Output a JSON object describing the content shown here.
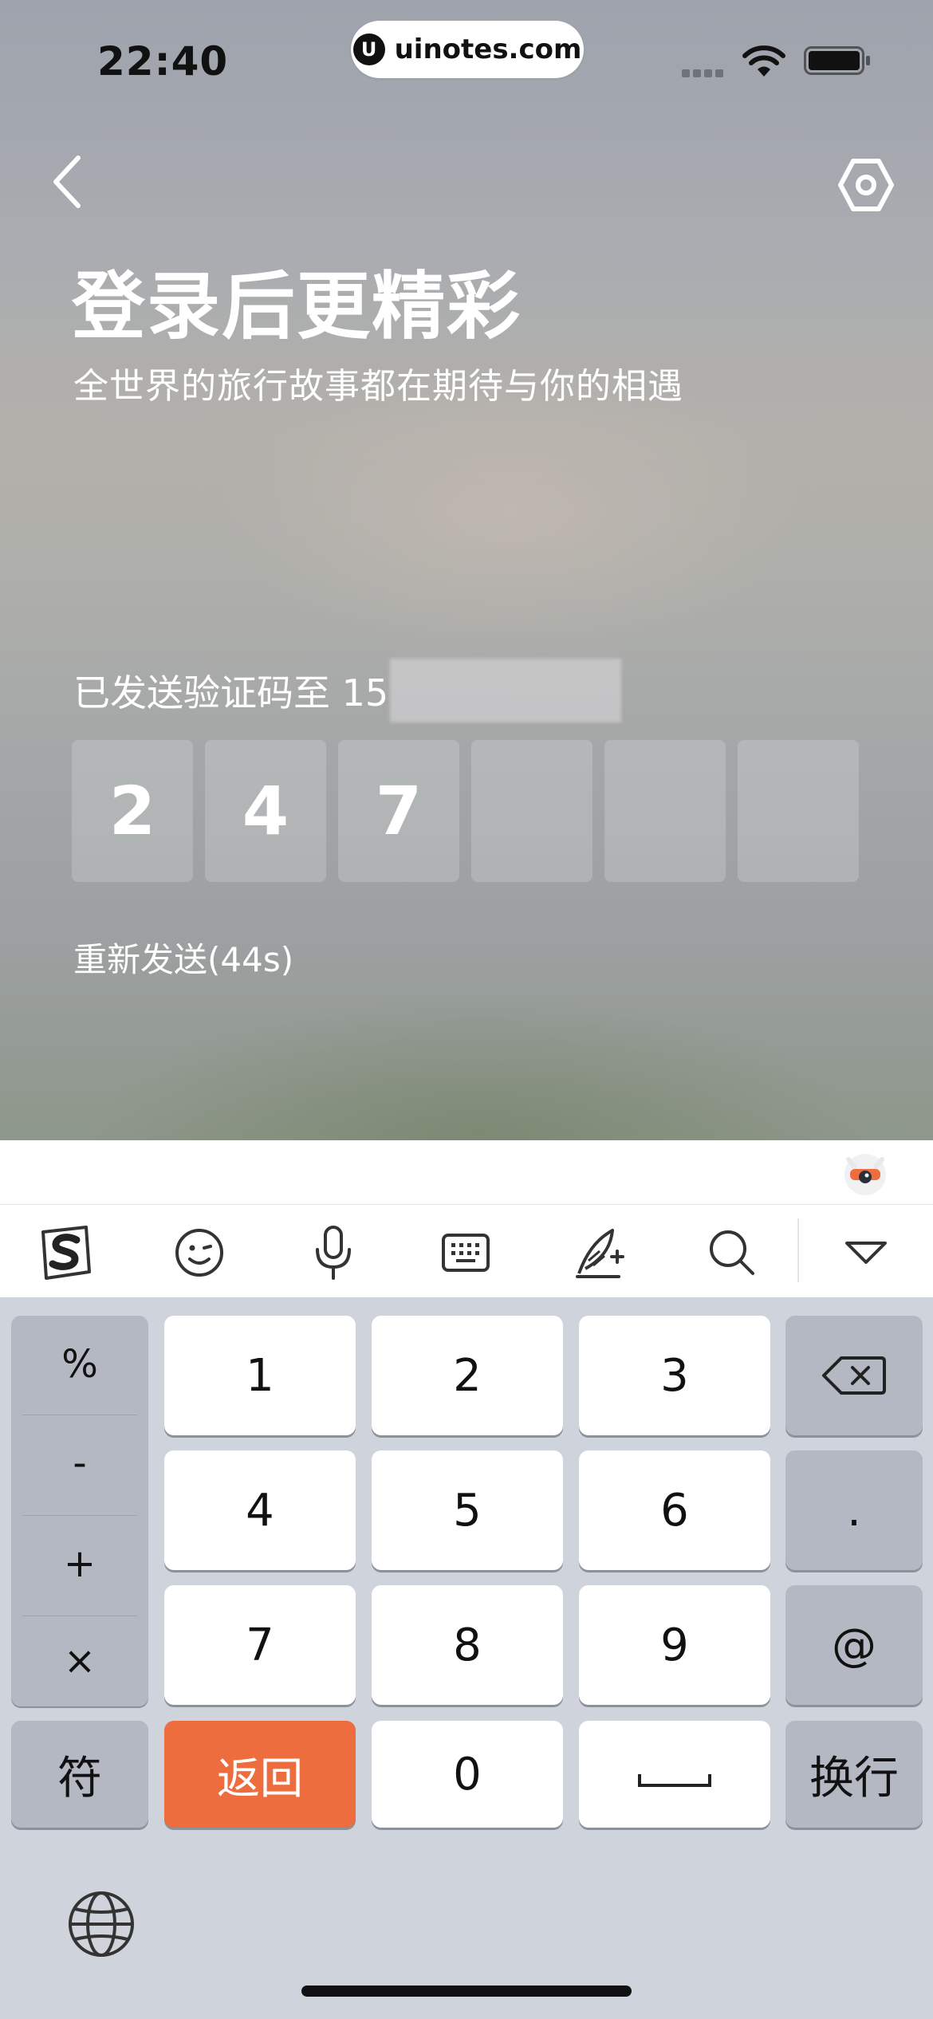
{
  "status_bar": {
    "time": "22:40",
    "url": "uinotes.com"
  },
  "header": {
    "title": "登录后更精彩",
    "subtitle": "全世界的旅行故事都在期待与你的相遇"
  },
  "verification": {
    "sent_prefix": "已发送验证码至 15",
    "digits": [
      "2",
      "4",
      "7",
      "",
      "",
      ""
    ],
    "resend": "重新发送(44s)"
  },
  "keyboard": {
    "symbols": [
      "%",
      "-",
      "+",
      "×"
    ],
    "row1": [
      "1",
      "2",
      "3"
    ],
    "row2": [
      "4",
      "5",
      "6"
    ],
    "row3": [
      "7",
      "8",
      "9"
    ],
    "side_keys": [
      ".",
      "@"
    ],
    "fn_symbols": "符",
    "return_key": "返回",
    "zero": "0",
    "newline": "换行",
    "accent_color": "#ee6d3f"
  },
  "icons": [
    "back-icon",
    "settings-icon",
    "sogou-logo-icon",
    "emoji-icon",
    "microphone-icon",
    "keyboard-icon",
    "handwriting-icon",
    "search-icon",
    "collapse-icon",
    "backspace-icon",
    "space-icon",
    "globe-icon"
  ]
}
